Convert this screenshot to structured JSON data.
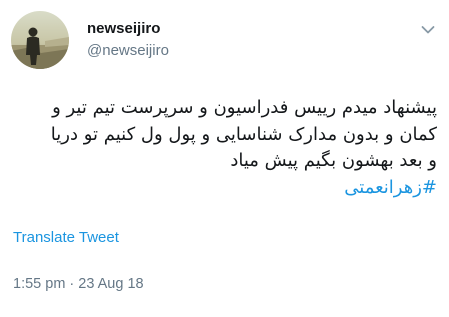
{
  "tweet": {
    "author": {
      "display_name": "newseijiro",
      "handle": "@newseijiro",
      "avatar_icon": "profile-photo-silhouette"
    },
    "menu_icon": "chevron-down-icon",
    "text_lines": [
      "پیشنهاد میدم رییس فدراسیون و سرپرست تیم تیر و",
      "کمان و بدون مدارک شناسایی و پول ول کنیم تو دریا",
      "و بعد بهشون بگیم پیش میاد"
    ],
    "hashtag": "#زهرانعمتی",
    "translate_label": "Translate Tweet",
    "timestamp": "1:55 pm · 23 Aug 18"
  },
  "colors": {
    "link_blue": "#1b95e0",
    "muted_gray": "#657786",
    "text_dark": "#14171a"
  }
}
